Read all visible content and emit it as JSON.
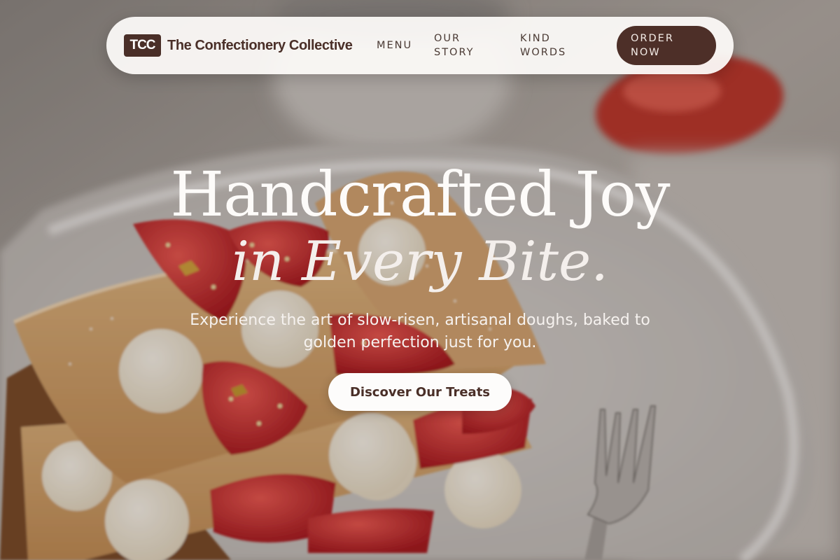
{
  "brand": {
    "logo_text": "TCC",
    "name": "The Confectionery Collective"
  },
  "nav": {
    "links": [
      {
        "label": "MENU"
      },
      {
        "label": "OUR STORY"
      },
      {
        "label": "KIND WORDS"
      }
    ],
    "order_label": "ORDER NOW"
  },
  "hero": {
    "headline_line1": "Handcrafted Joy",
    "headline_line2": "in Every Bite.",
    "subtitle": "Experience the art of slow-risen, artisanal doughs, baked to golden perfection just for you.",
    "cta_label": "Discover Our Treats",
    "image_description": "Strawberry and cream mille-feuille on a white plate with a silver fork"
  },
  "colors": {
    "brand_brown": "#4a2f28",
    "nav_background": "#fcfaf8",
    "cta_background": "#fdfcfb",
    "headline_text": "#fdfbf9"
  }
}
